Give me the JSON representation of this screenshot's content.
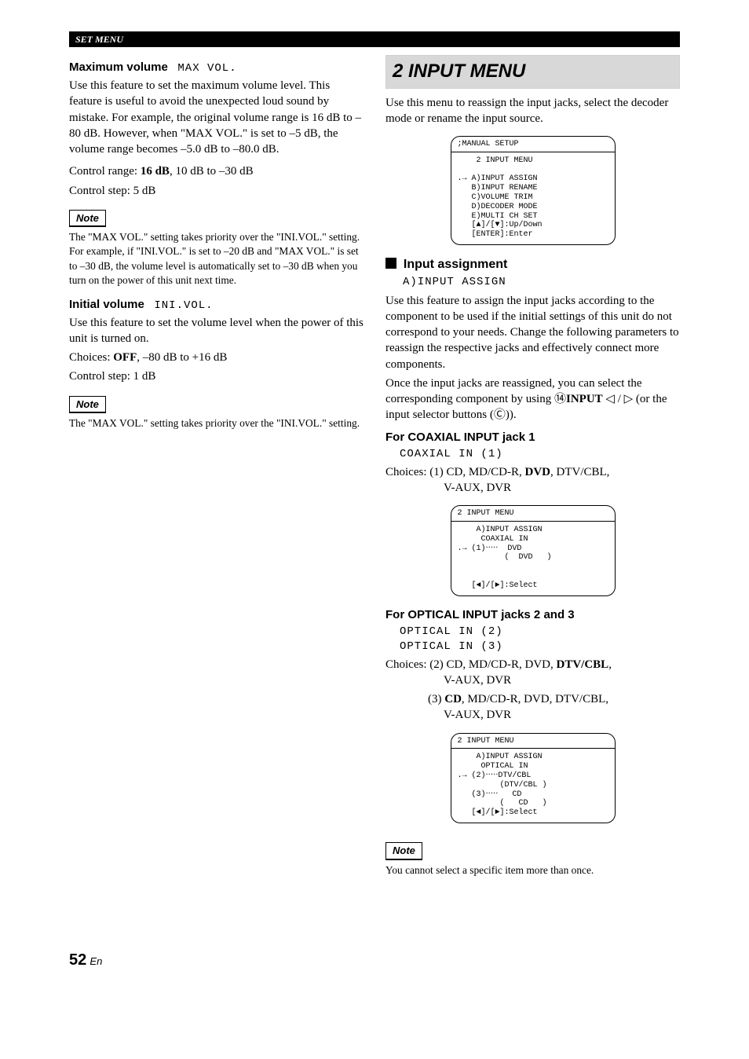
{
  "header": "SET MENU",
  "left": {
    "maxvol": {
      "heading": "Maximum volume",
      "heading_code": "MAX VOL.",
      "desc": "Use this feature to set the maximum volume level. This feature is useful to avoid the unexpected loud sound by mistake. For example, the original volume range is 16 dB to –80 dB. However, when \"MAX VOL.\" is set to –5 dB, the volume range becomes –5.0 dB to –80.0 dB.",
      "range_pre": "Control range: ",
      "range_bold": "16 dB",
      "range_post": ", 10 dB to –30 dB",
      "step": "Control step: 5 dB",
      "note_label": "Note",
      "note_text": "The \"MAX VOL.\" setting takes priority over the \"INI.VOL.\" setting. For example, if \"INI.VOL.\" is set to –20 dB and \"MAX VOL.\" is set to –30 dB, the volume level is automatically set to –30 dB when you turn on the power of this unit next time."
    },
    "inivol": {
      "heading": "Initial volume",
      "heading_code": "INI.VOL.",
      "desc": "Use this feature to set the volume level when the power of this unit is turned on.",
      "choices_pre": "Choices: ",
      "choices_bold": "OFF",
      "choices_post": ", –80 dB to +16 dB",
      "step": "Control step: 1 dB",
      "note_label": "Note",
      "note_text": "The \"MAX VOL.\" setting takes priority over the \"INI.VOL.\" setting."
    }
  },
  "right": {
    "title": "2 INPUT MENU",
    "intro": "Use this menu to reassign the input jacks, select the decoder mode or rename the input source.",
    "osd1": {
      "title": ";MANUAL SETUP",
      "body": "    2 INPUT MENU\n\n.→ A)INPUT ASSIGN\n   B)INPUT RENAME\n   C)VOLUME TRIM\n   D)DECODER MODE\n   E)MULTI CH SET\n   [▲]/[▼]:Up/Down\n   [ENTER]:Enter"
    },
    "input_assign": {
      "heading": "Input assignment",
      "code": "A)INPUT ASSIGN",
      "desc": "Use this feature to assign the input jacks according to the component to be used if the initial settings of this unit do not correspond to your needs. Change the following parameters to reassign the respective jacks and effectively connect more components.",
      "para2_pre": "Once the input jacks are reassigned, you can select the corresponding component by using ",
      "para2_key": "⑭",
      "para2_bold": "INPUT",
      "para2_mid": " (or the input selector buttons (",
      "para2_key2": "Ⓒ",
      "para2_end": "))."
    },
    "coax": {
      "heading": "For COAXIAL INPUT jack 1",
      "code": "COAXIAL IN (1)",
      "choices_pre": "Choices: (1) CD, MD/CD-R, ",
      "choices_bold": "DVD",
      "choices_post": ", DTV/CBL,",
      "choices_l2": "V-AUX, DVR",
      "osd": {
        "title": "2 INPUT MENU",
        "body": "    A)INPUT ASSIGN\n     COAXIAL IN\n.→ (1)‧‧‧‧‧  DVD\n          (  DVD   )\n\n\n   [◄]/[►]:Select"
      }
    },
    "opt": {
      "heading": "For OPTICAL INPUT jacks 2 and 3",
      "code1": "OPTICAL IN (2)",
      "code2": "OPTICAL IN (3)",
      "c2_pre": "Choices: (2) CD, MD/CD-R, DVD, ",
      "c2_bold": "DTV/CBL",
      "c2_post": ",",
      "c2_l2": "V-AUX, DVR",
      "c3_pre": "(3) ",
      "c3_bold": "CD",
      "c3_post": ", MD/CD-R, DVD, DTV/CBL,",
      "c3_l2": "V-AUX, DVR",
      "osd": {
        "title": "2 INPUT MENU",
        "body": "    A)INPUT ASSIGN\n     OPTICAL IN\n.→ (2)‧‧‧‧‧DTV/CBL\n         (DTV/CBL )\n   (3)‧‧‧‧‧   CD\n         (   CD   )\n   [◄]/[►]:Select"
      }
    },
    "note_label": "Note",
    "note_text": "You cannot select a specific item more than once."
  },
  "page": {
    "num": "52",
    "suffix": "En"
  }
}
